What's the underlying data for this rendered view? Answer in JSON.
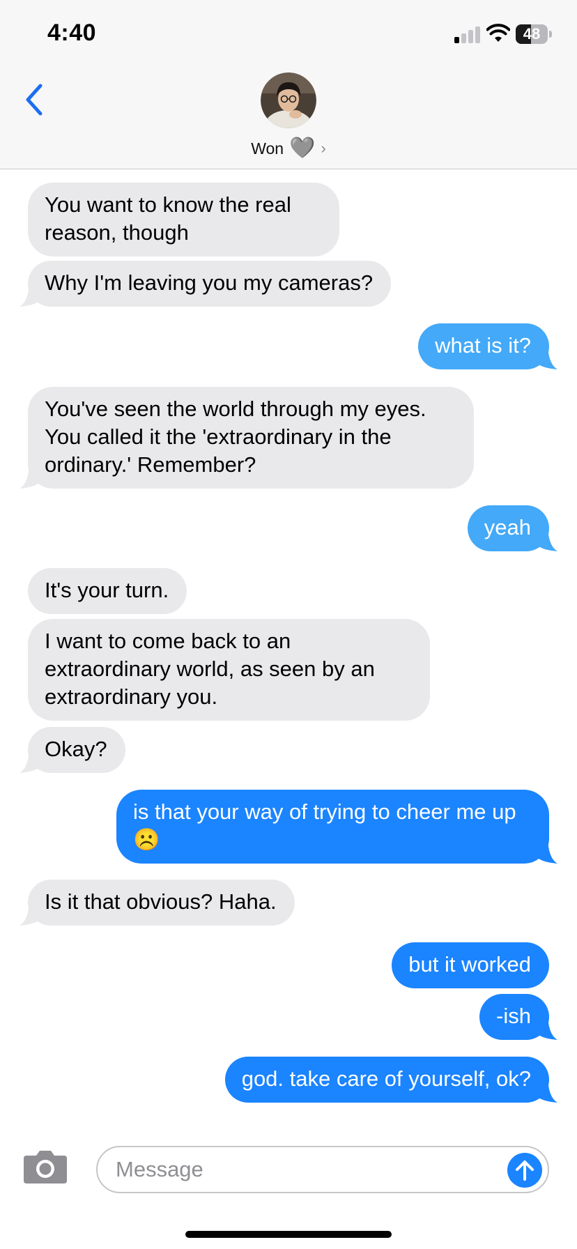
{
  "status_bar": {
    "time": "4:40",
    "battery_level": "48",
    "icons": [
      "cellular-signal-icon",
      "wifi-icon",
      "battery-icon"
    ]
  },
  "header": {
    "contact_name": "Won",
    "contact_emoji": "🩶",
    "chevron": "›",
    "icons": [
      "back-chevron-icon",
      "contact-avatar"
    ]
  },
  "colors": {
    "incoming_bubble": "#e9e9eb",
    "sent_bubble_blue": "#1b84ff",
    "sent_bubble_light_blue": "#43a9f8",
    "accent": "#1b6ff0"
  },
  "messages": [
    {
      "sender": "contact",
      "text": "You want to know the real reason, though",
      "tail": false
    },
    {
      "sender": "contact",
      "text": "Why I'm leaving you my cameras?",
      "tail": true
    },
    {
      "sender": "me",
      "text": "what is it?",
      "tail": true,
      "style": "light"
    },
    {
      "sender": "contact",
      "text": "You've seen the world through my eyes. You called it the 'extraordinary in the ordinary.' Remember?",
      "tail": true
    },
    {
      "sender": "me",
      "text": "yeah",
      "tail": true,
      "style": "light"
    },
    {
      "sender": "contact",
      "text": "It's your turn.",
      "tail": false
    },
    {
      "sender": "contact",
      "text": "I want to come back to an extraordinary world, as seen by an extraordinary you.",
      "tail": false
    },
    {
      "sender": "contact",
      "text": "Okay?",
      "tail": true
    },
    {
      "sender": "me",
      "text": "is that your way of trying to cheer me up ☹️",
      "tail": true,
      "style": "blue"
    },
    {
      "sender": "contact",
      "text": "Is it that obvious? Haha.",
      "tail": true
    },
    {
      "sender": "me",
      "text": "but it worked",
      "tail": false,
      "style": "blue"
    },
    {
      "sender": "me",
      "text": "-ish",
      "tail": true,
      "style": "blue"
    },
    {
      "sender": "me",
      "text": "god. take care of yourself, ok?",
      "tail": true,
      "style": "blue"
    }
  ],
  "composer": {
    "placeholder": "Message",
    "icons": [
      "camera-icon",
      "send-arrow-icon"
    ]
  }
}
